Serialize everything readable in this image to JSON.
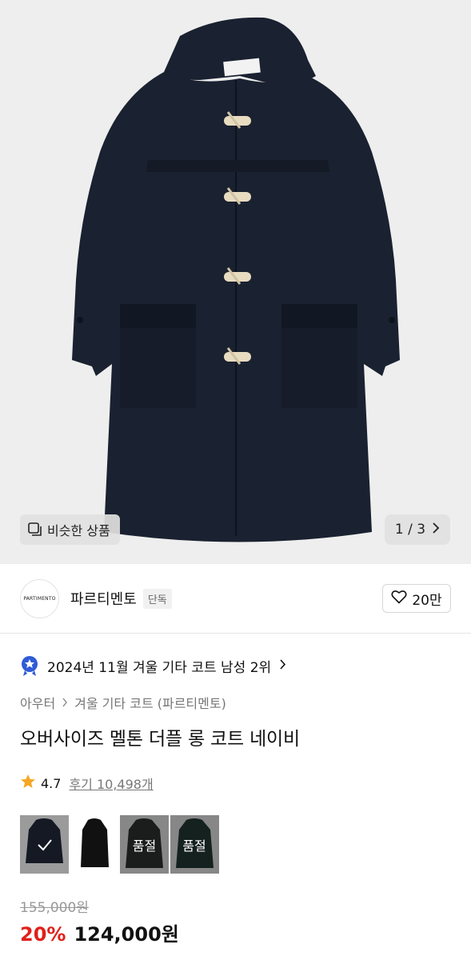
{
  "hero": {
    "similar_label": "비슷한 상품",
    "pager_text": "1 / 3",
    "image_alt": "navy duffle coat"
  },
  "brand": {
    "logo_text": "PARTIMENTO",
    "name": "파르티멘토",
    "tag": "단독",
    "like_count": "20만"
  },
  "ranking": {
    "text": "2024년 11월 겨울 기타 코트 남성 2위"
  },
  "breadcrumb": {
    "items": [
      "아우터",
      "겨울 기타 코트 (파르티멘토)"
    ]
  },
  "product": {
    "title": "오버사이즈 멜톤 더플 롱 코트 네이비",
    "rating": "4.7",
    "reviews": "후기 10,498개"
  },
  "swatches": [
    {
      "color": "#1b2230",
      "selected": true,
      "label": ""
    },
    {
      "color": "#111111",
      "selected": false,
      "label": ""
    },
    {
      "color": "#2a2d2c",
      "selected": false,
      "label": "품절"
    },
    {
      "color": "#1f3330",
      "selected": false,
      "label": "품절"
    }
  ],
  "price": {
    "original": "155,000원",
    "discount": "20%",
    "final": "124,000원"
  },
  "colors": {
    "accent_red": "#e0201a",
    "coat_navy": "#1a2130",
    "rank_badge": "#2f5bd6",
    "star": "#f5a623"
  }
}
